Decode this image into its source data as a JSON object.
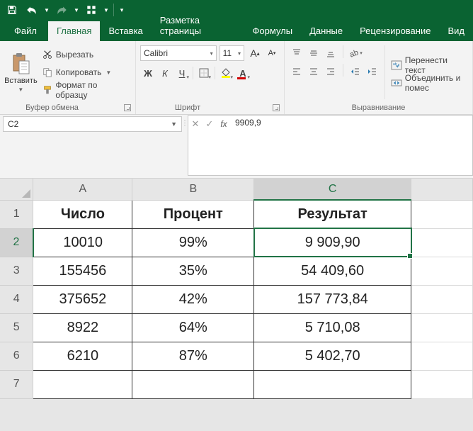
{
  "qat": {
    "save": "save-icon",
    "undo": "undo-icon",
    "redo": "redo-icon",
    "touch": "touch-mode-icon"
  },
  "tabs": {
    "file": "Файл",
    "home": "Главная",
    "insert": "Вставка",
    "page_layout": "Разметка страницы",
    "formulas": "Формулы",
    "data": "Данные",
    "review": "Рецензирование",
    "view": "Вид"
  },
  "ribbon": {
    "clipboard": {
      "paste": "Вставить",
      "cut": "Вырезать",
      "copy": "Копировать",
      "format_painter": "Формат по образцу",
      "label": "Буфер обмена"
    },
    "font": {
      "name": "Calibri",
      "size": "11",
      "bold": "Ж",
      "italic": "К",
      "underline": "Ч",
      "label": "Шрифт"
    },
    "alignment": {
      "wrap": "Перенести текст",
      "merge": "Объединить и помес",
      "label": "Выравнивание"
    }
  },
  "namebox": "C2",
  "formula": "9909,9",
  "columns": [
    "A",
    "B",
    "C"
  ],
  "rows": [
    "1",
    "2",
    "3",
    "4",
    "5",
    "6",
    "7"
  ],
  "sheet": {
    "headers": [
      "Число",
      "Процент",
      "Результат"
    ],
    "data": [
      [
        "10010",
        "99%",
        "9 909,90"
      ],
      [
        "155456",
        "35%",
        "54 409,60"
      ],
      [
        "375652",
        "42%",
        "157 773,84"
      ],
      [
        "8922",
        "64%",
        "5 710,08"
      ],
      [
        "6210",
        "87%",
        "5 402,70"
      ]
    ]
  },
  "selected": {
    "col": "C",
    "row": "2"
  },
  "colors": {
    "primary": "#217346",
    "titlebar": "#0a6332"
  }
}
